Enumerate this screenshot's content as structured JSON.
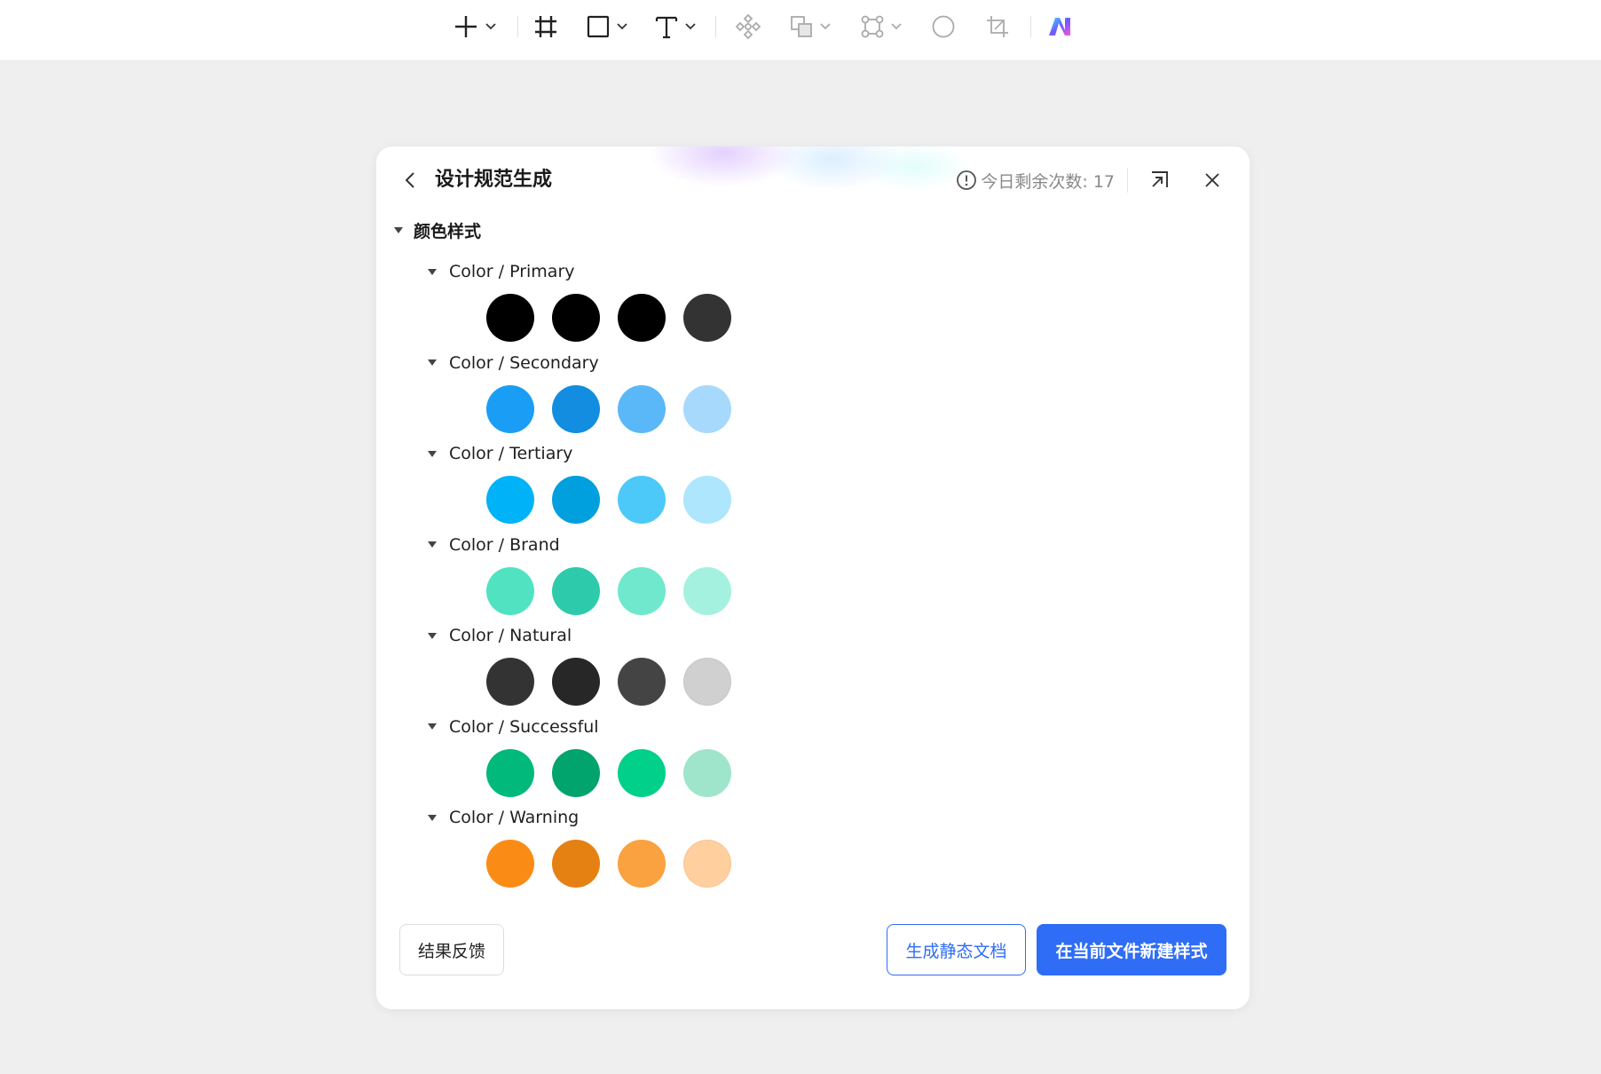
{
  "toolbar": {
    "tools": [
      {
        "name": "add-tool",
        "icon": "plus-icon",
        "has_menu": true
      },
      {
        "name": "frame-tool",
        "icon": "frame-icon",
        "has_menu": false
      },
      {
        "name": "rectangle-tool",
        "icon": "rectangle-icon",
        "has_menu": true
      },
      {
        "name": "text-tool",
        "icon": "text-icon",
        "has_menu": true
      },
      {
        "name": "component-tool",
        "icon": "component-icon",
        "has_menu": false
      },
      {
        "name": "boolean-tool",
        "icon": "boolean-icon",
        "has_menu": true
      },
      {
        "name": "vector-tool",
        "icon": "vector-icon",
        "has_menu": true
      },
      {
        "name": "ellipse-tool",
        "icon": "circle-icon",
        "has_menu": false
      },
      {
        "name": "crop-tool",
        "icon": "crop-icon",
        "has_menu": false
      },
      {
        "name": "ai-tool",
        "icon": "ai-logo-icon",
        "has_menu": false
      }
    ]
  },
  "dialog": {
    "title": "设计规范生成",
    "quota_label": "今日剩余次数: 17",
    "section_title": "颜色样式",
    "groups": [
      {
        "label": "Color / Primary",
        "colors": [
          "#000000",
          "#000000",
          "#000000",
          "#333333"
        ]
      },
      {
        "label": "Color / Secondary",
        "colors": [
          "#1a9ef5",
          "#128de0",
          "#5ab8f8",
          "#a6d9fc"
        ]
      },
      {
        "label": "Color / Tertiary",
        "colors": [
          "#00b2f7",
          "#009fde",
          "#4dc9f9",
          "#ade6fd"
        ]
      },
      {
        "label": "Color / Brand",
        "colors": [
          "#51e2c2",
          "#2dcbab",
          "#6fe8cd",
          "#a5f1e0"
        ]
      },
      {
        "label": "Color / Natural",
        "colors": [
          "#333333",
          "#272727",
          "#444444",
          "#d0d0d0"
        ]
      },
      {
        "label": "Color / Successful",
        "colors": [
          "#00b97a",
          "#00a46c",
          "#00d08a",
          "#9fe5cb"
        ]
      },
      {
        "label": "Color / Warning",
        "colors": [
          "#fa8c16",
          "#e58113",
          "#faa140",
          "#ffcf9e"
        ]
      }
    ],
    "footer": {
      "feedback_label": "结果反馈",
      "static_doc_label": "生成静态文档",
      "create_styles_label": "在当前文件新建样式"
    }
  },
  "colors": {
    "accent": "#2f6df6",
    "canvas": "#efefef"
  }
}
